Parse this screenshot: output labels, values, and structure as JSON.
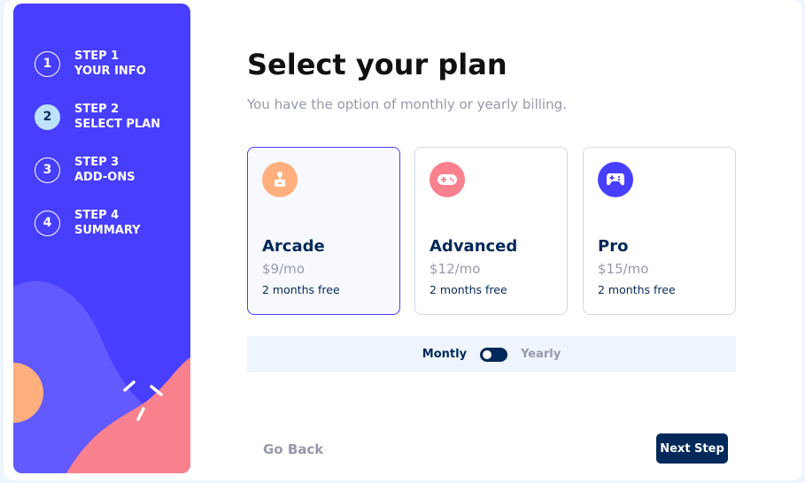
{
  "sidebar": {
    "steps": [
      {
        "number": "1",
        "step": "STEP 1",
        "label": "YOUR INFO",
        "active": false
      },
      {
        "number": "2",
        "step": "STEP 2",
        "label": "SELECT PLAN",
        "active": true
      },
      {
        "number": "3",
        "step": "STEP 3",
        "label": "ADD-ONS",
        "active": false
      },
      {
        "number": "4",
        "step": "STEP 4",
        "label": "SUMMARY",
        "active": false
      }
    ]
  },
  "main": {
    "title": "Select your plan",
    "subtitle": "You have the option of monthly or yearly billing.",
    "plans": [
      {
        "name": "Arcade",
        "price": "$9/mo",
        "promo": "2 months free",
        "icon": "arcade-icon",
        "color": "#ffaf7e",
        "selected": true
      },
      {
        "name": "Advanced",
        "price": "$12/mo",
        "promo": "2 months free",
        "icon": "gamepad-icon",
        "color": "#f9818e",
        "selected": false
      },
      {
        "name": "Pro",
        "price": "$15/mo",
        "promo": "2 months free",
        "icon": "controller-icon",
        "color": "#483eff",
        "selected": false
      }
    ],
    "billing": {
      "monthly": "Montly",
      "yearly": "Yearly",
      "selected": "monthly"
    },
    "go_back": "Go Back",
    "next_step": "Next Step"
  },
  "colors": {
    "primary": "#483eff",
    "marine": "#02295a",
    "gray": "#9699ab",
    "light_blue": "#bee2fd",
    "orange": "#ffaf7e",
    "pink": "#f9818e"
  }
}
